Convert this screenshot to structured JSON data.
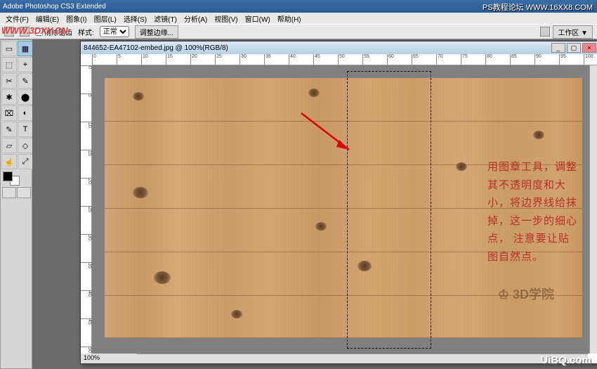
{
  "app_title": "Adobe Photoshop CS3 Extended",
  "menu": [
    "文件(F)",
    "编辑(E)",
    "图象(I)",
    "图层(L)",
    "选择(S)",
    "滤镜(T)",
    "分析(A)",
    "视图(V)",
    "窗口(W)",
    "帮助(H)"
  ],
  "options": {
    "alias_label": "消除锯齿",
    "style_label": "样式:",
    "style_value": "正常",
    "refine_edge": "调整边缘...",
    "workspace_label": "工作区 ▼"
  },
  "tools": [
    "▭",
    "▦",
    "⬚",
    "⌖",
    "✂",
    "✎",
    "✱",
    "⬤",
    "⌧",
    "◐",
    "✎",
    "T",
    "▱",
    "◇",
    "☝",
    "⤢",
    "✥",
    "⬜",
    "⚲",
    "⊞"
  ],
  "doc": {
    "title": "844652-EA47102-embed.jpg @ 100%(RGB/8)",
    "zoom": "100%",
    "ruler_marks_h": [
      "0",
      "5",
      "10",
      "15",
      "20",
      "25",
      "30",
      "35",
      "40",
      "45",
      "50",
      "55",
      "60",
      "65",
      "70",
      "75",
      "80",
      "85",
      "90",
      "95",
      "100"
    ],
    "ruler_marks_v": [
      "0",
      "5",
      "10",
      "15",
      "20",
      "25",
      "30",
      "35",
      "40",
      "45",
      "50"
    ]
  },
  "annotation": "用图章工具，调整其不透明度和大小，将边界线给抹掉，这一步的细心点，  注意要让贴图自然点。",
  "watermarks": {
    "top_left": "WWW.3DXY.CN",
    "top_right": "PS教程论坛  WWW.16XX8.COM",
    "bottom_right": "UiBQ.com",
    "canvas_logo": "♔ 3D学院"
  }
}
